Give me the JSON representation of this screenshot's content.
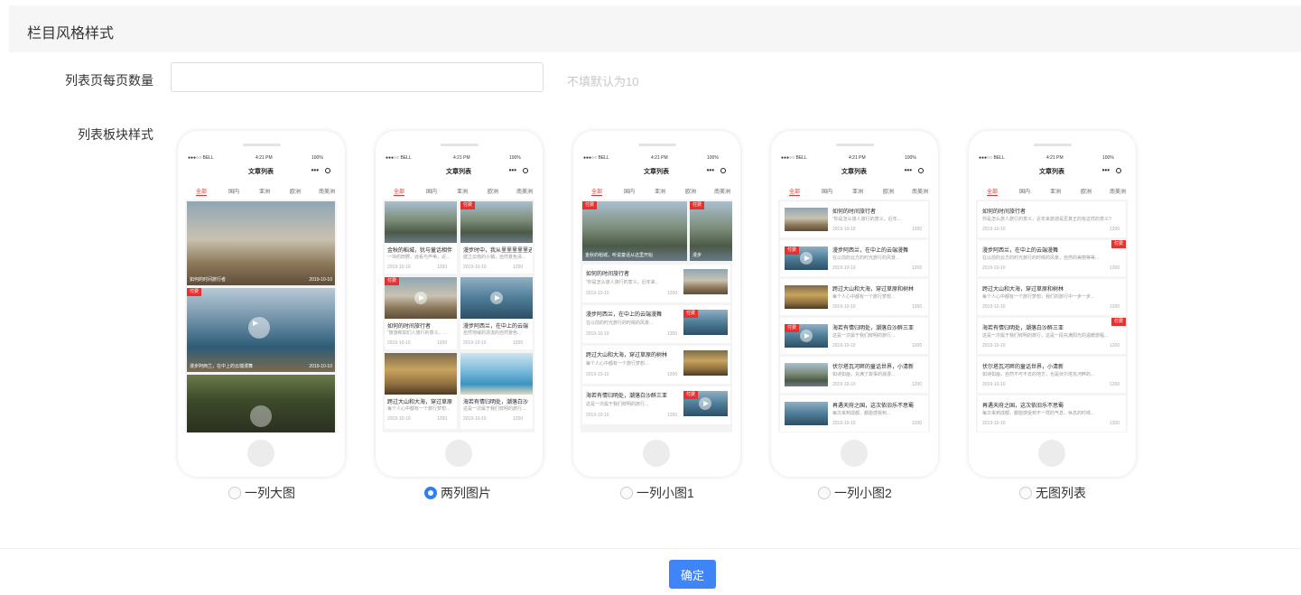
{
  "section": {
    "title": "栏目风格样式"
  },
  "per_page": {
    "label": "列表页每页数量",
    "value": "",
    "hint": "不填默认为10"
  },
  "style": {
    "label": "列表板块样式"
  },
  "phone": {
    "carrier": "●●●○○ BELL",
    "time": "4:21 PM",
    "battery": "100%",
    "title": "文章列表",
    "tabs": [
      "全部",
      "国内",
      "亚洲",
      "欧洲",
      "南美洲"
    ]
  },
  "options": [
    {
      "label": "一列大图",
      "checked": false
    },
    {
      "label": "两列图片",
      "checked": true
    },
    {
      "label": "一列小图1",
      "checked": false
    },
    {
      "label": "一列小图2",
      "checked": false
    },
    {
      "label": "无图列表",
      "checked": false
    }
  ],
  "previews": {
    "big": {
      "c1": "如何的时间旅行者",
      "d1": "2019-10-10",
      "c2": "漫步阿西兰，在中上的云端漫舞",
      "d2": "2019-10-10",
      "views": "1200",
      "tag": "付费"
    },
    "two": {
      "t1": "金秋的稻城，犹与童话相伴",
      "s1": "一块的田野，远看与芦苇，近...",
      "t2": "漫步时中，我从里里里里里进",
      "s2": "建立云南的小镇，自然景色清...",
      "t3": "如何的时间旅行者",
      "s3": "“旅游和如们人旅行的意义，...",
      "t4": "漫步阿西兰，在中上的云端",
      "s4": "自然地域的漂流的自然景色...",
      "t5": "跨过大山和大海，穿过草原",
      "s5": "每个人心中都有一个旅行梦想...",
      "t6": "海若有情归明处，潮落白沙",
      "s6": "这是一次属于我们鲜明的旅行...",
      "date": "2019-10-10",
      "views": "1200",
      "tag": "付费"
    },
    "small1": {
      "c1": "金秋的稻城，听说童话从这里开始",
      "c2": "漫步",
      "t1": "如何的时间旅行者",
      "s1": "“你是怎么旅人旅行的意义，近年来...",
      "t2": "漫步阿西兰，在中上的云端漫舞",
      "s2": "在以前的时光旅行的时候的风景...",
      "t3": "跨过大山和大海，穿过草原的树林",
      "s3": "每个人心中都有一个旅行梦想...",
      "t4": "海若有情归明处，潮落白沙醉三亚",
      "s4": "这是一次属于我们鲜明的旅行...",
      "date": "2019-10-10",
      "views": "1200",
      "tag": "付费"
    },
    "small2": {
      "t1": "如何的时间旅行者",
      "s1": "“你是怎么旅人旅行的意义，近年...",
      "t2": "漫步阿西兰，在中上的云端漫舞",
      "s2": "在以前的云方的时光旅行的风景...",
      "t3": "跨过大山和大海，穿过草原和树林",
      "s3": "每个人心中都有一个旅行梦想...",
      "t4": "海若有情归明处，潮落白沙醉三亚",
      "s4": "这是一次属于我们鲜明的旅行...",
      "t5": "伏尔塔瓦河畔的童话世界，小清新",
      "s5": "如诗如画，充满了故事的浪漫...",
      "t6": "再遇天府之国，这次依旧乐不思蜀",
      "s6": "每次来到成都，都能感受到...",
      "date": "2019-10-10",
      "views": "1200",
      "tag": "付费"
    },
    "noimg": {
      "t1": "如何的时间旅行者",
      "s1": "你是怎么旅人旅行的意义，近年来旅游是否真正的有这样的意义?",
      "t2": "漫步阿西兰，在中上的云端漫舞",
      "s2": "在以前的云方的时光旅行的时候的风景，自然的美丽等等...",
      "t3": "跨过大山和大海，穿过草原和树林",
      "s3": "每个人心中都有一个旅行梦想，我们的旅行中一步一步...",
      "t4": "海若有情归明处，潮落白沙醉三亚",
      "s4": "这是一次属于我们鲜明的旅行，这是一段充满阳光的温暖旅程...",
      "t5": "伏尔塔瓦河畔的童话世界，小清新",
      "s5": "如诗如画，自然不可不去的地方，也是伏尔塔瓦河畔的...",
      "t6": "再遇天府之国，这次依旧乐不思蜀",
      "s6": "每次来到成都，都能感受到不一样的气息，休息的时候...",
      "date": "2019-10-10",
      "views": "1200",
      "tag": "付费"
    }
  },
  "confirm_label": "确定"
}
